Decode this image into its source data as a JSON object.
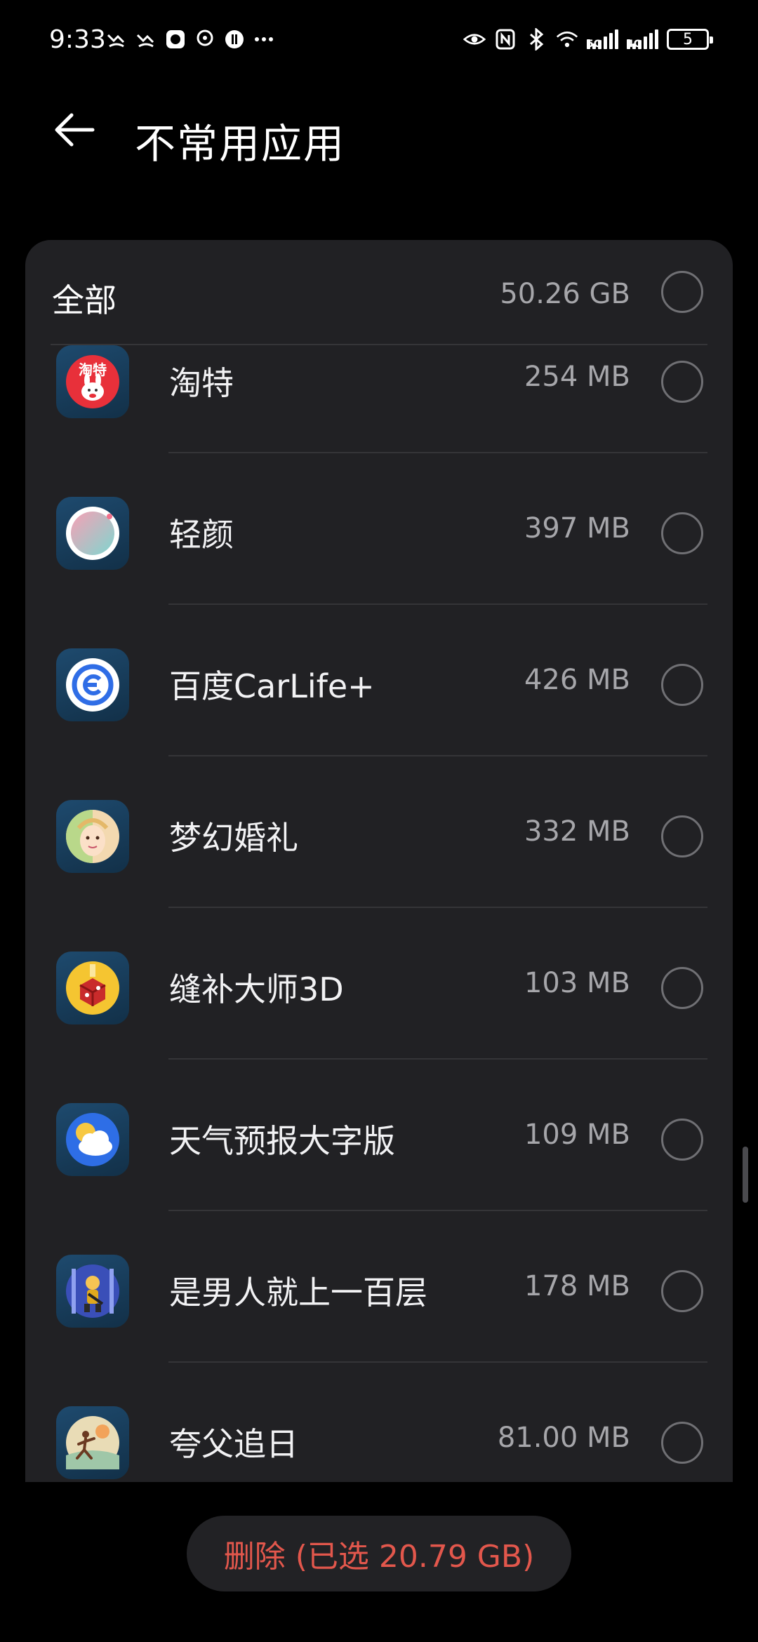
{
  "status_bar": {
    "time": "9:33",
    "left_icons": [
      "missed-call-icon",
      "missed-call-icon",
      "app-notification-icon",
      "hotspot-icon",
      "game-icon",
      "more-dots-icon"
    ],
    "right_icons": [
      "eye-comfort-icon",
      "nfc-icon",
      "bluetooth-icon",
      "wifi-icon",
      "signal-5g-icon",
      "signal-4g-icon"
    ],
    "net_5g": "5G",
    "net_4g": "4G",
    "battery": "5"
  },
  "header": {
    "title": "不常用应用",
    "back_icon": "back-arrow-icon"
  },
  "list": {
    "all_label": "全部",
    "all_size": "50.26 GB",
    "items": [
      {
        "name": "淘特",
        "size": "254 MB",
        "icon": "taote-app-icon"
      },
      {
        "name": "轻颜",
        "size": "397 MB",
        "icon": "qingyan-app-icon"
      },
      {
        "name": "百度CarLife+",
        "size": "426 MB",
        "icon": "baidu-carlife-app-icon"
      },
      {
        "name": "梦幻婚礼",
        "size": "332 MB",
        "icon": "dream-wedding-app-icon"
      },
      {
        "name": "缝补大师3D",
        "size": "103 MB",
        "icon": "sewing-master-app-icon"
      },
      {
        "name": "天气预报大字版",
        "size": "109 MB",
        "icon": "weather-app-icon"
      },
      {
        "name": "是男人就上一百层",
        "size": "178 MB",
        "icon": "hundred-floors-app-icon"
      },
      {
        "name": "夸父追日",
        "size": "81.00 MB",
        "icon": "kuafu-app-icon"
      }
    ]
  },
  "taote_icon_text": "淘特",
  "delete_button": "删除 (已选 20.79 GB)",
  "colors": {
    "background": "#000000",
    "card": "#212124",
    "danger": "#e2574c",
    "muted": "#a6a6aa"
  }
}
